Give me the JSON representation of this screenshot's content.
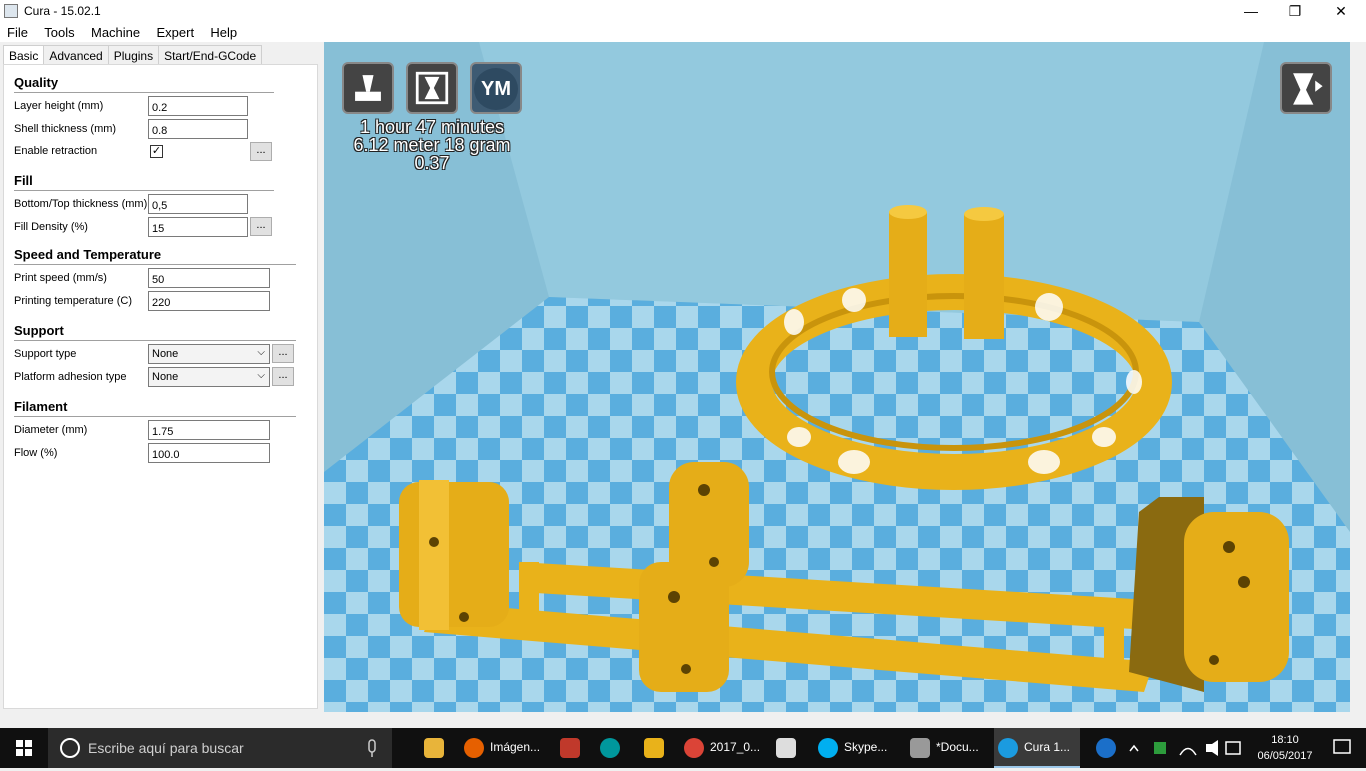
{
  "window": {
    "title": "Cura - 15.02.1",
    "minimize": "—",
    "maximize": "❐",
    "close": "✕"
  },
  "menu": [
    "File",
    "Tools",
    "Machine",
    "Expert",
    "Help"
  ],
  "tabs": [
    "Basic",
    "Advanced",
    "Plugins",
    "Start/End-GCode"
  ],
  "quality": {
    "title": "Quality",
    "layer_height_label": "Layer height (mm)",
    "layer_height": "0.2",
    "shell_thickness_label": "Shell thickness (mm)",
    "shell_thickness": "0.8",
    "retraction_label": "Enable retraction",
    "retraction_checked": "✓"
  },
  "fill": {
    "title": "Fill",
    "bottom_top_label": "Bottom/Top thickness (mm)",
    "bottom_top": "0,5",
    "density_label": "Fill Density (%)",
    "density": "15"
  },
  "speed": {
    "title": "Speed and Temperature",
    "print_speed_label": "Print speed (mm/s)",
    "print_speed": "50",
    "temp_label": "Printing temperature (C)",
    "temp": "220"
  },
  "support": {
    "title": "Support",
    "type_label": "Support type",
    "type": "None",
    "adhesion_label": "Platform adhesion type",
    "adhesion": "None"
  },
  "filament": {
    "title": "Filament",
    "diameter_label": "Diameter (mm)",
    "diameter": "1.75",
    "flow_label": "Flow (%)",
    "flow": "100.0"
  },
  "dots": "...",
  "viewport": {
    "yagv_label": "YM",
    "time": "1 hour 47 minutes",
    "material": "6.12 meter 18 gram",
    "cost": "0.37",
    "colors": {
      "bg": "#87bfd6",
      "bed_light": "#a9d7ec",
      "bed_dark": "#5aaede",
      "model": "#f0b81c"
    }
  },
  "taskbar": {
    "search_placeholder": "Escribe aquí para buscar",
    "items": [
      "Imágen...",
      "2017_0...",
      "Skype...",
      "*Docu...",
      "Cura 1..."
    ],
    "time": "18:10",
    "date": "06/05/2017"
  }
}
